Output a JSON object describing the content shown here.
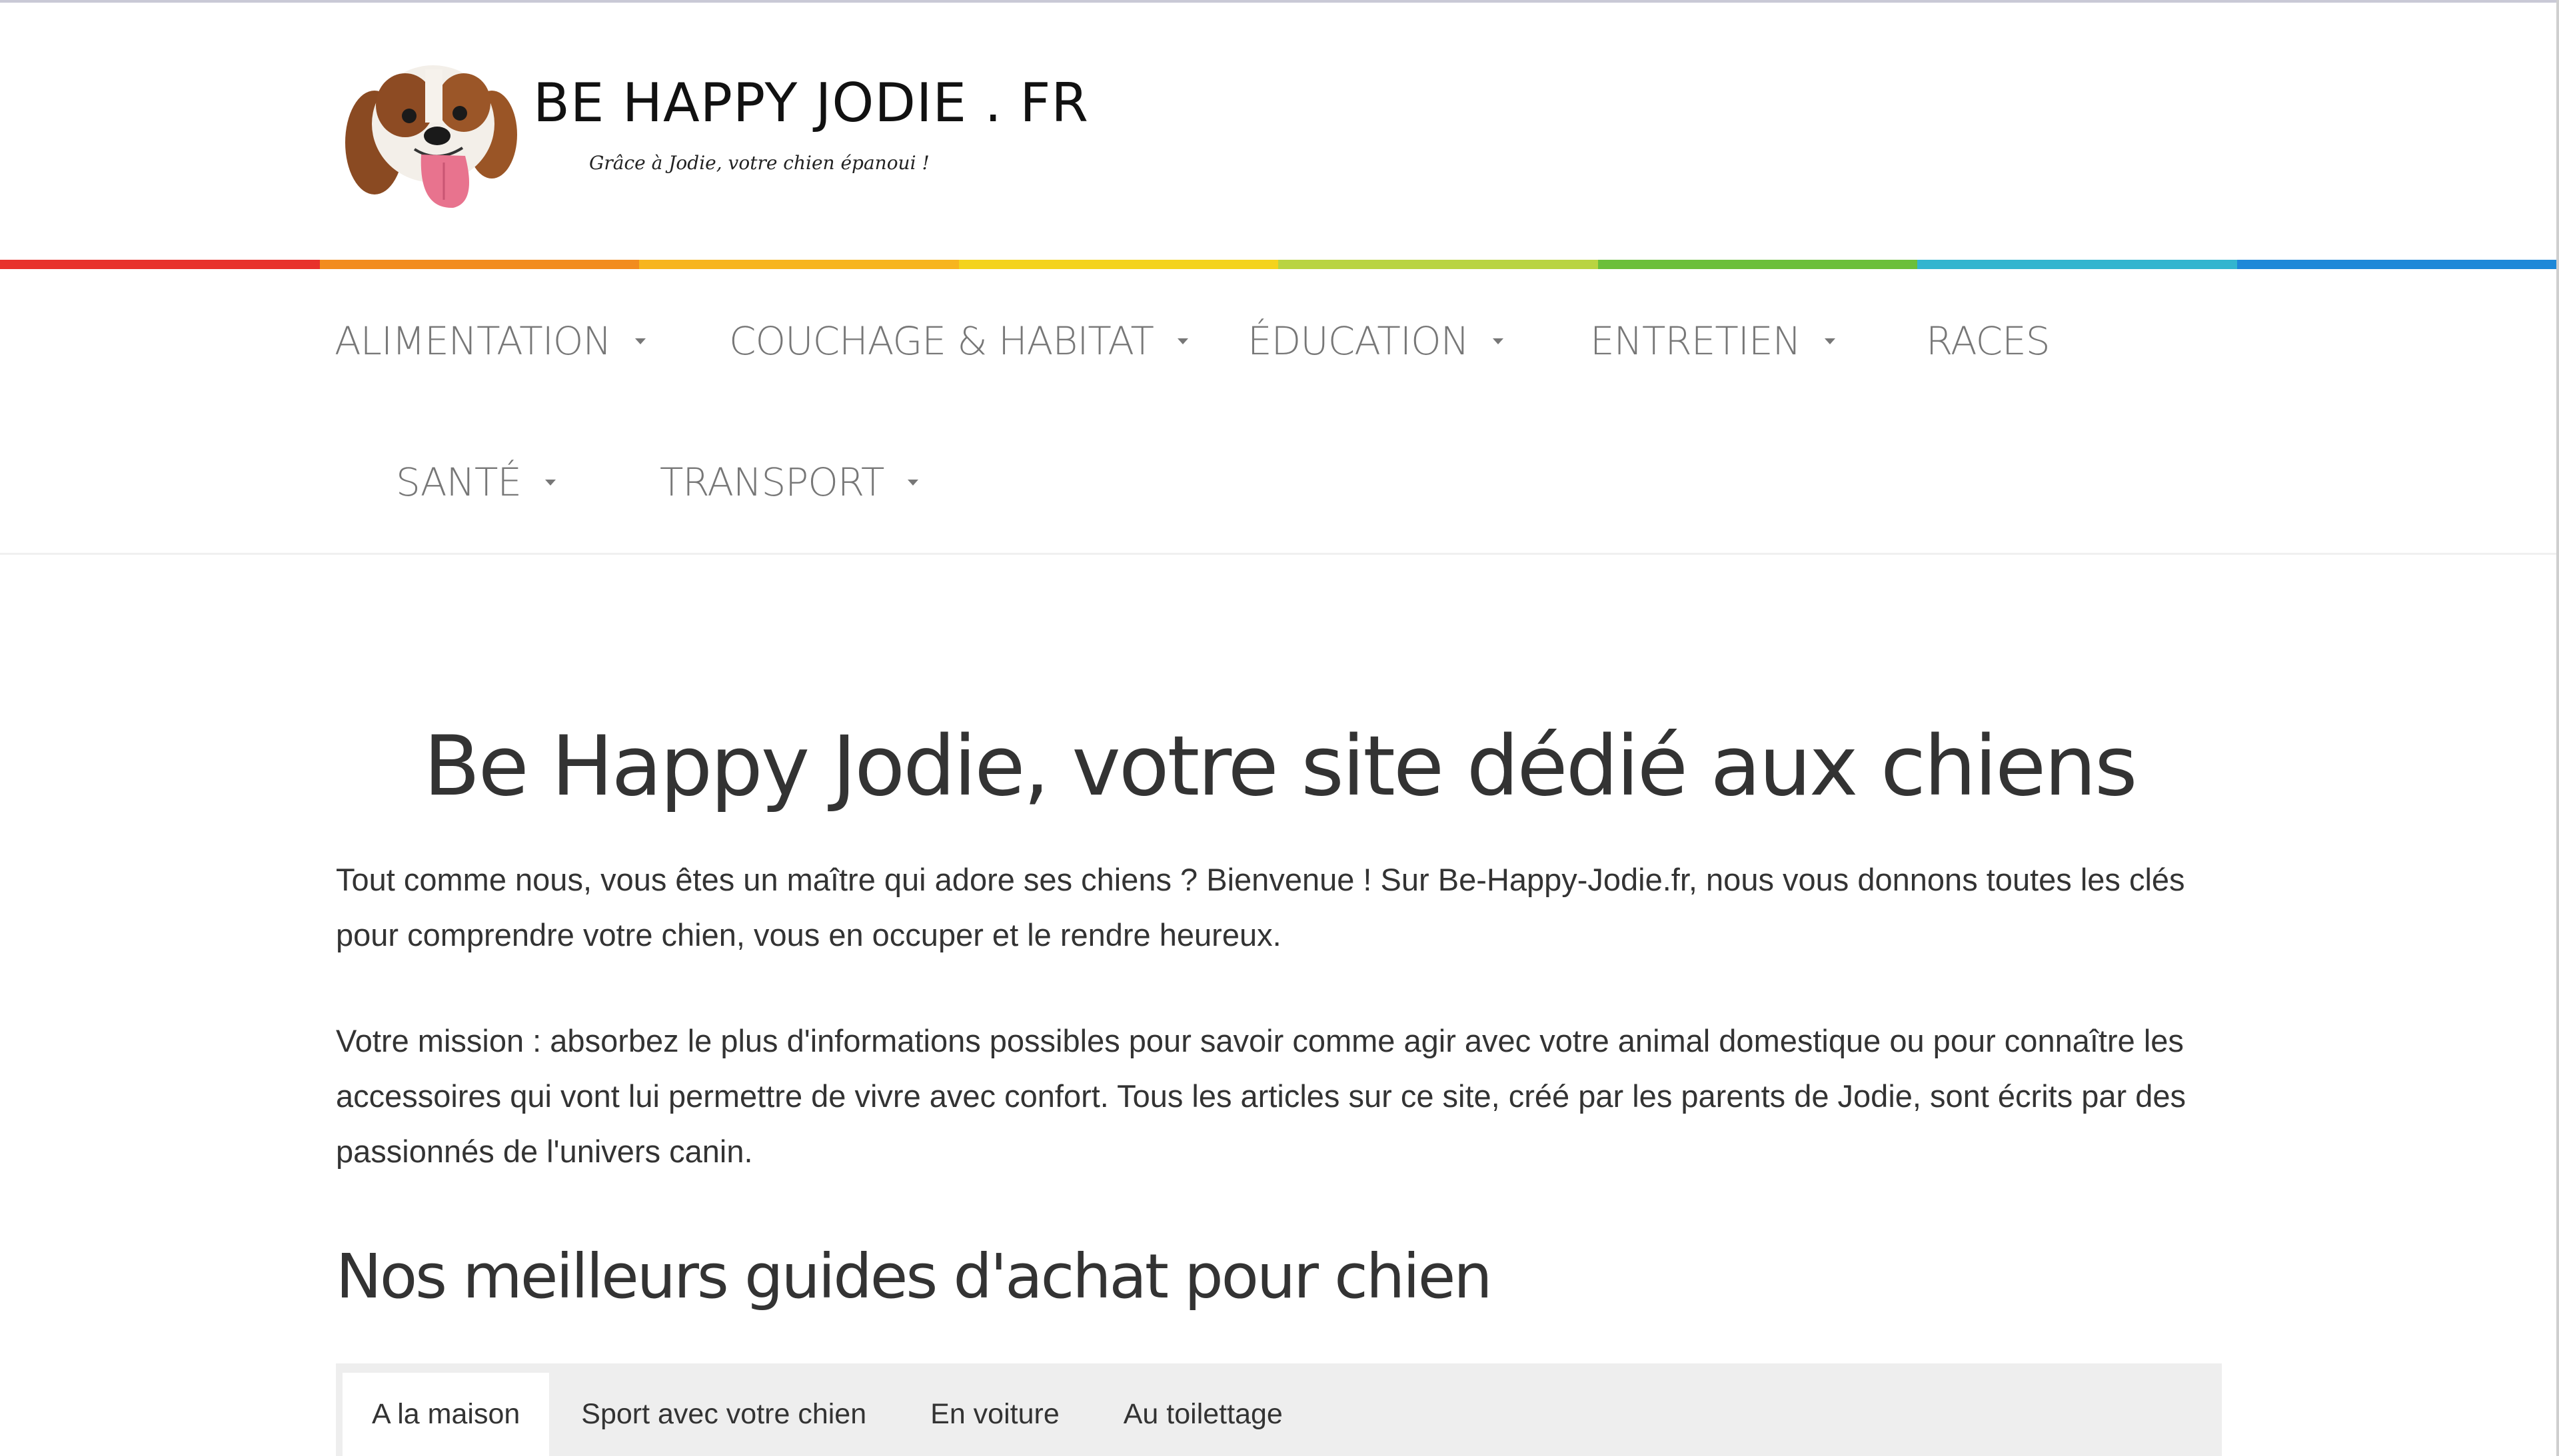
{
  "header": {
    "site_title": "BE HAPPY JODIE . FR",
    "tagline": "Grâce à Jodie, votre chien épanoui !",
    "logo_alt": "dog-face-logo"
  },
  "rainbow_colors": [
    "#e8312b",
    "#f28c1e",
    "#f7b51e",
    "#f4d31c",
    "#b9d441",
    "#6bbf3a",
    "#33b5cf",
    "#1e88d8"
  ],
  "nav": {
    "items": [
      {
        "label": "ALIMENTATION",
        "has_submenu": true
      },
      {
        "label": "COUCHAGE & HABITAT",
        "has_submenu": true
      },
      {
        "label": "ÉDUCATION",
        "has_submenu": true
      },
      {
        "label": "ENTRETIEN",
        "has_submenu": true
      },
      {
        "label": "RACES",
        "has_submenu": false
      },
      {
        "label": "SANTÉ",
        "has_submenu": true
      },
      {
        "label": "TRANSPORT",
        "has_submenu": true
      }
    ]
  },
  "main": {
    "title": "Be Happy Jodie, votre site dédié aux chiens",
    "paragraph_1": "Tout comme nous, vous êtes un maître qui adore ses chiens ? Bienvenue ! Sur Be-Happy-Jodie.fr, nous vous donnons toutes les clés pour comprendre votre chien, vous en occuper et le rendre heureux.",
    "paragraph_2": "Votre mission : absorbez le plus d'informations possibles pour savoir comme agir avec votre animal domestique ou pour connaître les accessoires qui vont lui permettre de vivre avec confort. Tous les articles sur ce site, créé par les parents de Jodie, sont écrits par des passionnés de l'univers canin.",
    "section_title": "Nos meilleurs guides d'achat pour chien",
    "tabs": [
      {
        "label": "A la maison",
        "active": true
      },
      {
        "label": "Sport avec votre chien",
        "active": false
      },
      {
        "label": "En voiture",
        "active": false
      },
      {
        "label": "Au toilettage",
        "active": false
      }
    ]
  }
}
